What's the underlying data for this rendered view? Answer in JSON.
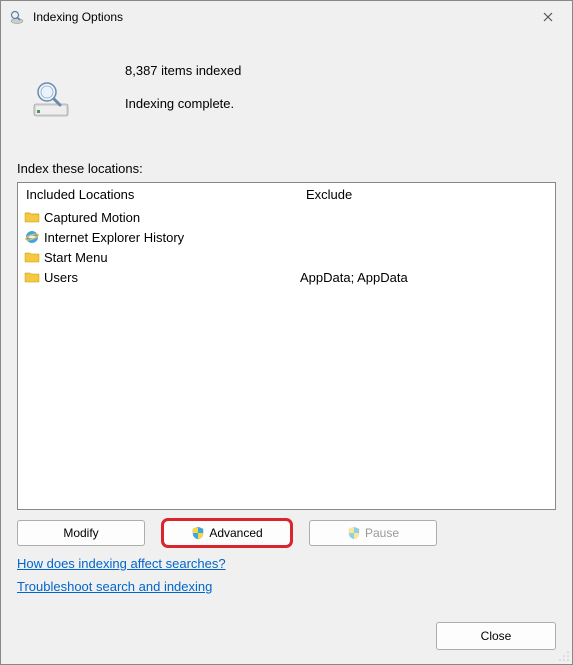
{
  "window": {
    "title": "Indexing Options"
  },
  "status": {
    "count_text": "8,387 items indexed",
    "message": "Indexing complete."
  },
  "locations": {
    "label": "Index these locations:",
    "headers": {
      "included": "Included Locations",
      "exclude": "Exclude"
    },
    "rows": [
      {
        "icon": "folder",
        "name": "Captured Motion",
        "exclude": ""
      },
      {
        "icon": "ie",
        "name": "Internet Explorer History",
        "exclude": ""
      },
      {
        "icon": "folder",
        "name": "Start Menu",
        "exclude": ""
      },
      {
        "icon": "folder",
        "name": "Users",
        "exclude": "AppData; AppData"
      }
    ]
  },
  "buttons": {
    "modify": "Modify",
    "advanced": "Advanced",
    "pause": "Pause",
    "close": "Close"
  },
  "links": {
    "how": "How does indexing affect searches?",
    "troubleshoot": "Troubleshoot search and indexing"
  }
}
